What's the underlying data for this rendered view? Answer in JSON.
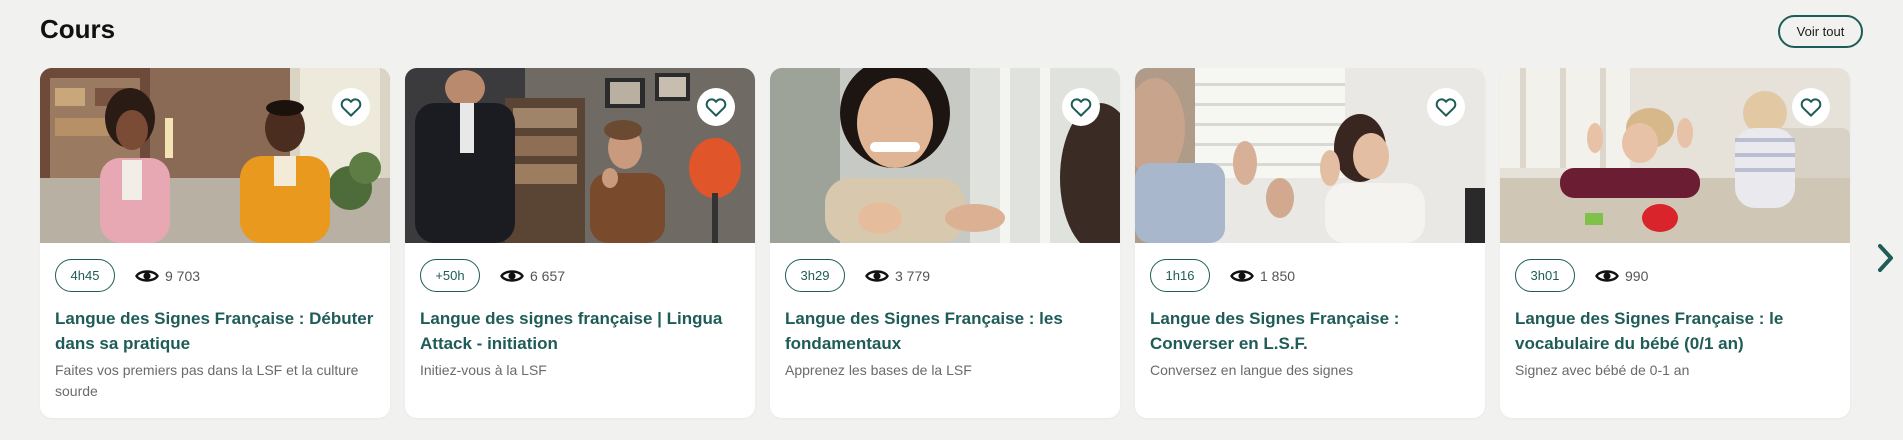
{
  "section": {
    "title": "Cours",
    "see_all_label": "Voir tout"
  },
  "cards": [
    {
      "duration": "4h45",
      "views": "9 703",
      "title": "Langue des Signes Française : Débuter dans sa pratique",
      "subtitle": "Faites vos premiers pas dans la LSF et la culture sourde",
      "image": "photo-two-people-signing-on-sofa"
    },
    {
      "duration": "+50h",
      "views": "6 657",
      "title": "Langue des signes française | Lingua Attack - initiation",
      "subtitle": "Initiez-vous à la LSF",
      "image": "photo-man-and-woman-signing-in-office"
    },
    {
      "duration": "3h29",
      "views": "3 779",
      "title": "Langue des Signes Française : les fondamentaux",
      "subtitle": "Apprenez les bases de la LSF",
      "image": "photo-smiling-woman-signing"
    },
    {
      "duration": "1h16",
      "views": "1 850",
      "title": "Langue des Signes Française : Converser en L.S.F.",
      "subtitle": "Conversez en langue des signes",
      "image": "photo-two-people-conversing-in-sign"
    },
    {
      "duration": "3h01",
      "views": "990",
      "title": "Langue des Signes Française : le vocabulaire du bébé (0/1 an)",
      "subtitle": "Signez avec bébé de 0-1 an",
      "image": "photo-mother-signing-with-baby"
    }
  ],
  "icons": {
    "favorite": "heart-outline-icon",
    "views": "eye-icon",
    "next": "chevron-right-icon"
  },
  "colors": {
    "accent": "#1f5c57",
    "background": "#f1f1ef",
    "card": "#ffffff"
  }
}
